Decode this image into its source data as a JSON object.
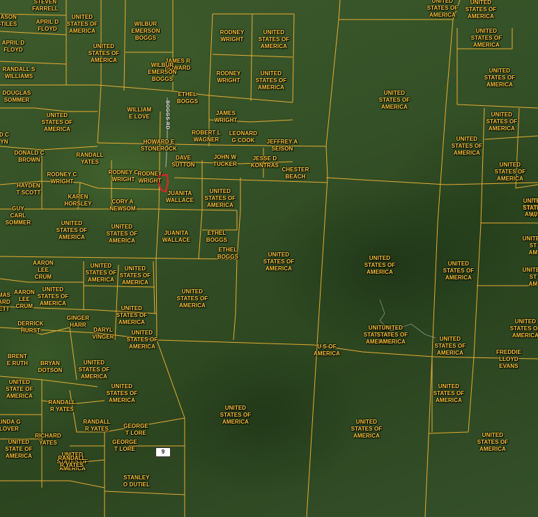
{
  "map": {
    "road_label": "BOGGS RD",
    "route_shield": "9",
    "boundary_color": "#f2b233",
    "highlight_color": "#e8222a",
    "label_color": "#f5c23a",
    "owner_labels": [
      "STEVEN\nFARRELL",
      "JASON\nSTILES",
      "UNITED\nSTATES OF\nAMERICA",
      "WILBUR\nEMERSON\nBOGGS",
      "RODNEY\nWRIGHT",
      "UNITED\nSTATES OF\nAMERICA",
      "UNITED\nSTATES OF\nAMERICA",
      "UNITED\nSTATES OF\nAMERICA",
      "APRIL D\nFLOYD",
      "APRIL D\nFLOYD",
      "UNITED\nSTATES OF\nAMERICA",
      "JAMES R\nHOWARD",
      "WILBUR\nEMERSON\nBOGGS",
      "RODNEY\nWRIGHT",
      "UNITED\nSTATES OF\nAMERICA",
      "RANDALL S\nWILLIAMS",
      "UNITED\nSTATES OF\nAMERICA",
      "UNITED\nSTATES OF\nAMERICA",
      "DOUGLAS\nSOMMER",
      "ETHEL\nBOGGS",
      "UNITED\nSTATES OF\nAMERICA",
      "WILLIAM\nE LOVE",
      "UNITED\nSTATES OF\nAMERICA",
      "UNITED\nSTATES OF\nAMERICA",
      "JAMES\nWRIGHT",
      "UNITED\nSTATES OF\nAMERICA",
      "D C\nYN",
      "ROBERT L\nWAGNER",
      "LEONARD\nG COOK",
      "JEFFREY A\nSEISON",
      "HOWARD E\nSTONEROCK",
      "UNITED\nSTATES OF\nAMERICA",
      "DONALD C\nBROWN",
      "RANDALL\nYATES",
      "DAVE\nSUTTON",
      "JOHN W\nTUCKER",
      "JESSE D\nKONTRAS",
      "UNITED\nSTATES OF\nAMERICA",
      "RODNEY C\nWRIGHT",
      "RODNEY C\nWRIGHT",
      "RODNEY\nWRIGHT",
      "CHESTER\nBEACH",
      "HAYDEN\nT SCOTT",
      "JUANITA\nWALLACE",
      "UNITED\nSTATES OF\nAMERICA",
      "KAREN\nHORSLEY",
      "CORY A\nNEWSOM",
      "GUY\nCARL\nSOMMER",
      "UNITED\nSTATES\nAV",
      "UNITED\nSTATES OF\nAMERICA",
      "UNITED\nSTATES OF\nAMERICA",
      "JUANITA\nWALLACE",
      "ETHEL\nBOGGS",
      "ETHEL\nBOGGS",
      "UNITED\nSTATES OF\nAMERICA",
      "UNITED\nSTATES OF\nAMERICA",
      "UNITED\nSTATES OF\nAMERICA",
      "UNITED\nST\nAM",
      "AARON\nLEE\nCRUM",
      "UNITED\nSTATES OF\nAMERICA",
      "UNITED\nSTATES OF\nAMERICA",
      "UNITED\nSTATES OF\nAMERICA",
      "UNITED\nST\nAM",
      "AARON\nLEE\nCRUM",
      "UNITED\nSTATES OF\nAMERICA",
      "MAS\nARD\nETT",
      "UNITED\nSTATES OF\nAMERICA",
      "UNITED\nSTATES OF\nAMERICA",
      "DERRICK\nHURST",
      "GINGER\nHARR",
      "DARYL\nVINGER",
      "UNITED\nSTATES OF\nAMERICA",
      "UNITED\nSTATES OF\nAMERICA",
      "UNITED\nSTATES OF\nAMERICA",
      "U S OF\nAMERICA",
      "BRENT\nE RUTH",
      "BRYAN\nDOTSON",
      "UNITED\nSTATES OF\nAMERICA",
      "FREDDIE\nLLOYD\nEVANS",
      "UNITED\nSTATE OF\nAMERICA",
      "UNITED\nSTATES OF\nAMERICA",
      "UNITED\nSTATES OF\nAMERICA",
      "UNITED\nSTATES OF\nAMERICA",
      "RANDALL\nR YATES",
      "UNITED\nSTATES OF\nAMERICA",
      "LINDA G\nLOVER",
      "RANDALL\nR YATES",
      "GEORGE\nT LORE",
      "UNITED\nSTATES OF\nAMERICA",
      "UNITED\nSTATES OF\nAMERICA",
      "RICHARD\nYATES",
      "GEORGE\nT LORE",
      "UNITED\nSTATE OF\nAMERICA",
      "UNITED\nSTATES OF\nAMERICA",
      "RANDALL\nR YATES",
      "STANLEY\nO DUTIEL"
    ]
  }
}
